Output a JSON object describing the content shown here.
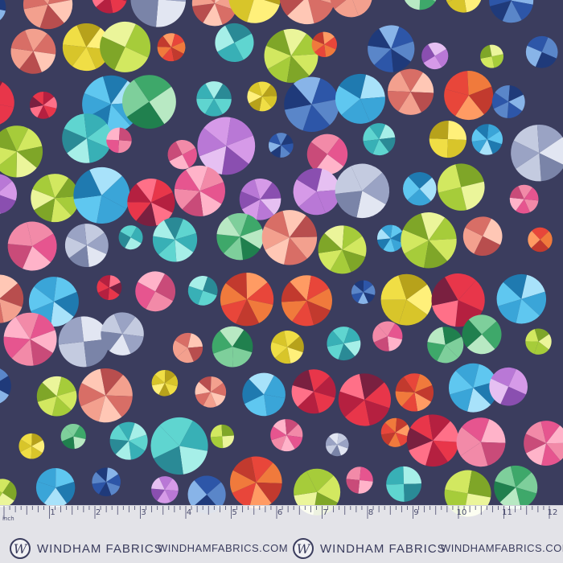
{
  "palette": {
    "background": "#3b3d5e",
    "swatches": [
      [
        "#e8463a",
        "#f07a3c",
        "#c23a2e",
        "#ff9b63"
      ],
      [
        "#f28aa8",
        "#e6558f",
        "#ffb3c9",
        "#c94b79"
      ],
      [
        "#2d56a8",
        "#5a86c9",
        "#1f3a7a",
        "#88b4e8"
      ],
      [
        "#d8c52a",
        "#f0de45",
        "#b7a21b",
        "#fff07a"
      ],
      [
        "#7ecf9b",
        "#3ea86a",
        "#b8e9c3",
        "#20804e"
      ],
      [
        "#b978d6",
        "#d69ae8",
        "#8a4fb0",
        "#e6c0f2"
      ],
      [
        "#f3a08e",
        "#d86e66",
        "#ffc7b5",
        "#b84e4e"
      ],
      [
        "#5fd5d0",
        "#38b0b6",
        "#a6efe8",
        "#2a8a96"
      ],
      [
        "#e8364a",
        "#b52040",
        "#ff7088",
        "#7a2040"
      ],
      [
        "#c4cbe0",
        "#9aa3c4",
        "#e2e6f2",
        "#7a84a8"
      ],
      [
        "#a6cc3a",
        "#d2e860",
        "#7fa628",
        "#ebf59a"
      ],
      [
        "#3aa5d8",
        "#5fc7f0",
        "#1f7ab0",
        "#a8e2fa"
      ]
    ]
  },
  "ruler": {
    "unit_label": "inch",
    "numbers": [
      "1",
      "2",
      "3",
      "4",
      "5",
      "6",
      "7",
      "8",
      "9",
      "10",
      "11",
      "12"
    ]
  },
  "brand": {
    "logo_letter": "W",
    "name": "WINDHAM FABRICS",
    "url": "WINDHAMFABRICS.COM"
  }
}
